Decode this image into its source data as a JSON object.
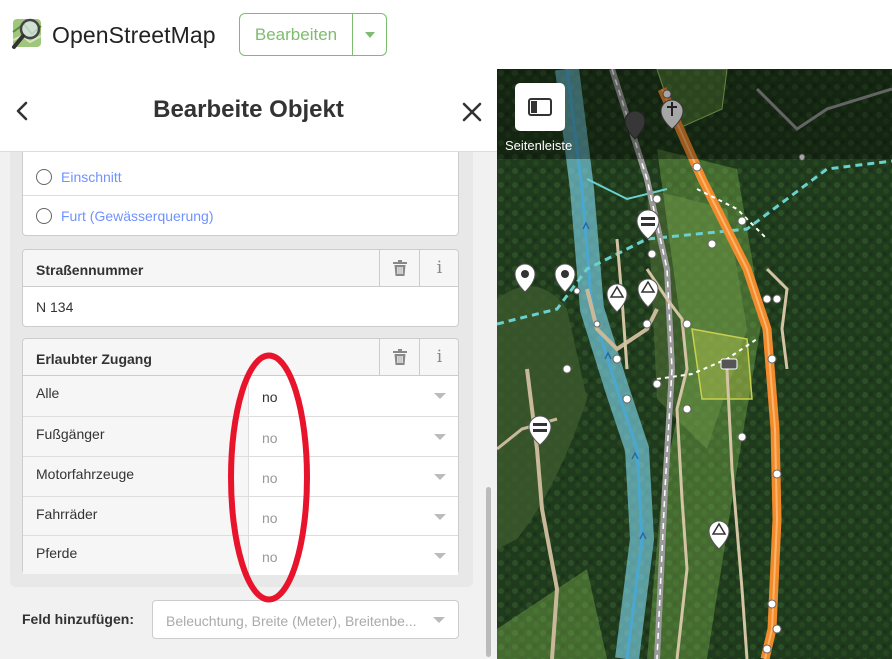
{
  "app": {
    "brand": "OpenStreetMap"
  },
  "toolbar": {
    "edit_label": "Bearbeiten"
  },
  "sidebar": {
    "title": "Bearbeite Objekt",
    "radio_options": [
      {
        "label": "Einschnitt"
      },
      {
        "label": "Furt (Gewässerquerung)"
      }
    ],
    "street_number": {
      "label": "Straßennummer",
      "value": "N 134"
    },
    "access": {
      "label": "Erlaubter Zugang",
      "rows": [
        {
          "label": "Alle",
          "value": "no",
          "placeholder": false
        },
        {
          "label": "Fußgänger",
          "value": "no",
          "placeholder": true
        },
        {
          "label": "Motorfahrzeuge",
          "value": "no",
          "placeholder": true
        },
        {
          "label": "Fahrräder",
          "value": "no",
          "placeholder": true
        },
        {
          "label": "Pferde",
          "value": "no",
          "placeholder": true
        }
      ]
    },
    "add_field": {
      "label": "Feld hinzufügen:",
      "placeholder": "Beleuchtung, Breite (Meter), Breitenbe..."
    }
  },
  "map": {
    "sidebar_toggle_label": "Seitenleiste"
  },
  "colors": {
    "accent_green": "#7ebc6f",
    "link_blue": "#7092ff",
    "annotation_red": "#e8142b"
  }
}
